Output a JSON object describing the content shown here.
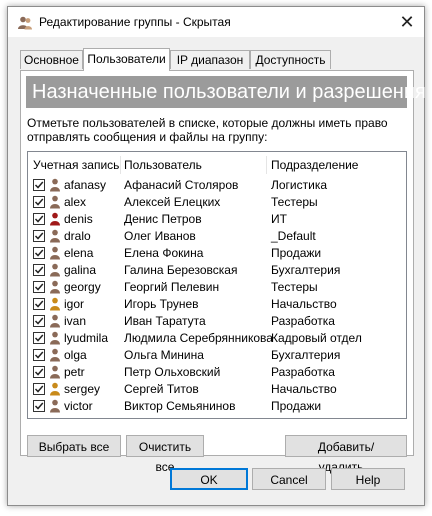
{
  "window": {
    "title": "Редактирование группы - Скрытая"
  },
  "tabs": [
    {
      "label": "Основное"
    },
    {
      "label": "Пользователи"
    },
    {
      "label": "IP диапазон"
    },
    {
      "label": "Доступность"
    }
  ],
  "panel": {
    "header": "Назначенные пользователи и разрешения",
    "description": "Отметьте пользователей в списке, которые должны иметь право отправлять сообщения и файлы на группу:"
  },
  "columns": {
    "account": "Учетная запись",
    "user": "Пользователь",
    "department": "Подразделение"
  },
  "rows": [
    {
      "account": "afanasy",
      "user": "Афанасий Столяров",
      "department": "Логистика",
      "checked": true,
      "icon_color": "#8a6a58"
    },
    {
      "account": "alex",
      "user": "Алексей Елецких",
      "department": "Тестеры",
      "checked": true,
      "icon_color": "#8a6a58"
    },
    {
      "account": "denis",
      "user": "Денис Петров",
      "department": "ИТ",
      "checked": true,
      "icon_color": "#a01818"
    },
    {
      "account": "dralo",
      "user": "Олег Иванов",
      "department": "_Default",
      "checked": true,
      "icon_color": "#8a6a58"
    },
    {
      "account": "elena",
      "user": "Елена Фокина",
      "department": "Продажи",
      "checked": true,
      "icon_color": "#8a6a58"
    },
    {
      "account": "galina",
      "user": "Галина Березовская",
      "department": "Бухгалтерия",
      "checked": true,
      "icon_color": "#8a6a58"
    },
    {
      "account": "georgy",
      "user": "Георгий Пелевин",
      "department": "Тестеры",
      "checked": true,
      "icon_color": "#8a6a58"
    },
    {
      "account": "igor",
      "user": "Игорь Трунев",
      "department": "Начальство",
      "checked": true,
      "icon_color": "#c88a1a"
    },
    {
      "account": "ivan",
      "user": "Иван Таратута",
      "department": "Разработка",
      "checked": true,
      "icon_color": "#8a6a58"
    },
    {
      "account": "lyudmila",
      "user": "Людмила Серебрянникова",
      "department": "Кадровый отдел",
      "checked": true,
      "icon_color": "#8a6a58"
    },
    {
      "account": "olga",
      "user": "Ольга Минина",
      "department": "Бухгалтерия",
      "checked": true,
      "icon_color": "#8a6a58"
    },
    {
      "account": "petr",
      "user": "Петр Ольховский",
      "department": "Разработка",
      "checked": true,
      "icon_color": "#8a6a58"
    },
    {
      "account": "sergey",
      "user": "Сергей Титов",
      "department": "Начальство",
      "checked": true,
      "icon_color": "#c88a1a"
    },
    {
      "account": "victor",
      "user": "Виктор Семьянинов",
      "department": "Продажи",
      "checked": true,
      "icon_color": "#8a6a58"
    }
  ],
  "buttons": {
    "select_all": "Выбрать все",
    "clear_all": "Очистить все",
    "add_remove": "Добавить/удалить...",
    "ok": "OK",
    "cancel": "Cancel",
    "help": "Help"
  },
  "colors": {
    "header_banner": "#9b9b9b",
    "accent": "#0078d7"
  }
}
